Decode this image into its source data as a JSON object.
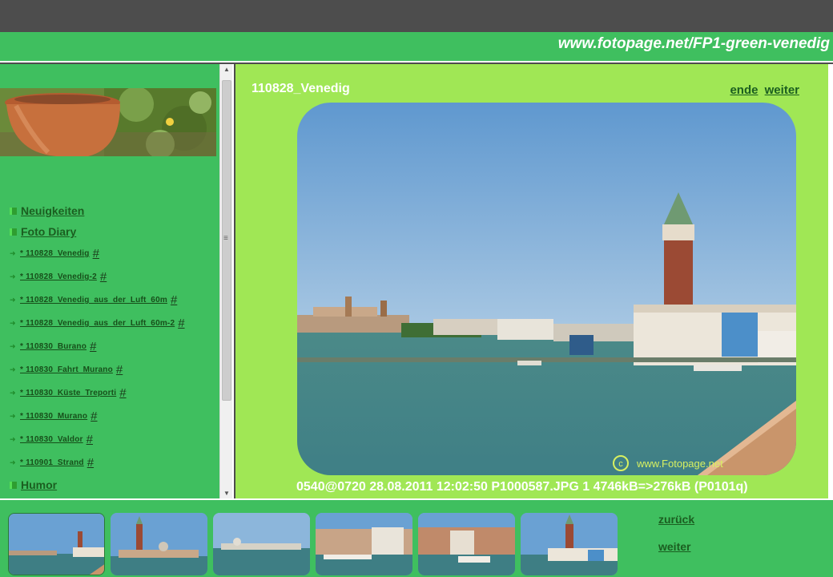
{
  "site_url": "www.fotopage.net/FP1-green-venedig",
  "sidebar": {
    "menu": [
      {
        "label": "Neuigkeiten"
      },
      {
        "label": "Foto Diary"
      }
    ],
    "sub_items": [
      {
        "label": "* 110828_Venedig",
        "hash": "#"
      },
      {
        "label": "* 110828_Venedig-2",
        "hash": "#"
      },
      {
        "label": "* 110828_Venedig_aus_der_Luft_60m",
        "hash": "#"
      },
      {
        "label": "* 110828_Venedig_aus_der_Luft_60m-2",
        "hash": "#"
      },
      {
        "label": "* 110830_Burano",
        "hash": "#"
      },
      {
        "label": "* 110830_Fahrt_Murano",
        "hash": "#"
      },
      {
        "label": "* 110830_Küste_Treporti",
        "hash": "#"
      },
      {
        "label": "* 110830_Murano",
        "hash": "#"
      },
      {
        "label": "* 110830_Valdor",
        "hash": "#"
      },
      {
        "label": "* 110901_Strand",
        "hash": "#"
      }
    ],
    "menu_after": {
      "label": "Humor"
    }
  },
  "main": {
    "title": "110828_Venedig",
    "nav_end": "ende",
    "nav_next": "weiter",
    "watermark": "www.Fotopage.net",
    "caption": "0540@0720 28.08.2011 12:02:50 P1000587.JPG 1 4746kB=>276kB (P0101q)"
  },
  "bottom": {
    "prev_label": "zurück",
    "next_label": "weiter"
  },
  "colors": {
    "header_green": "#3fbf5f",
    "main_green": "#a0e755",
    "link_green": "#1b5e20"
  }
}
